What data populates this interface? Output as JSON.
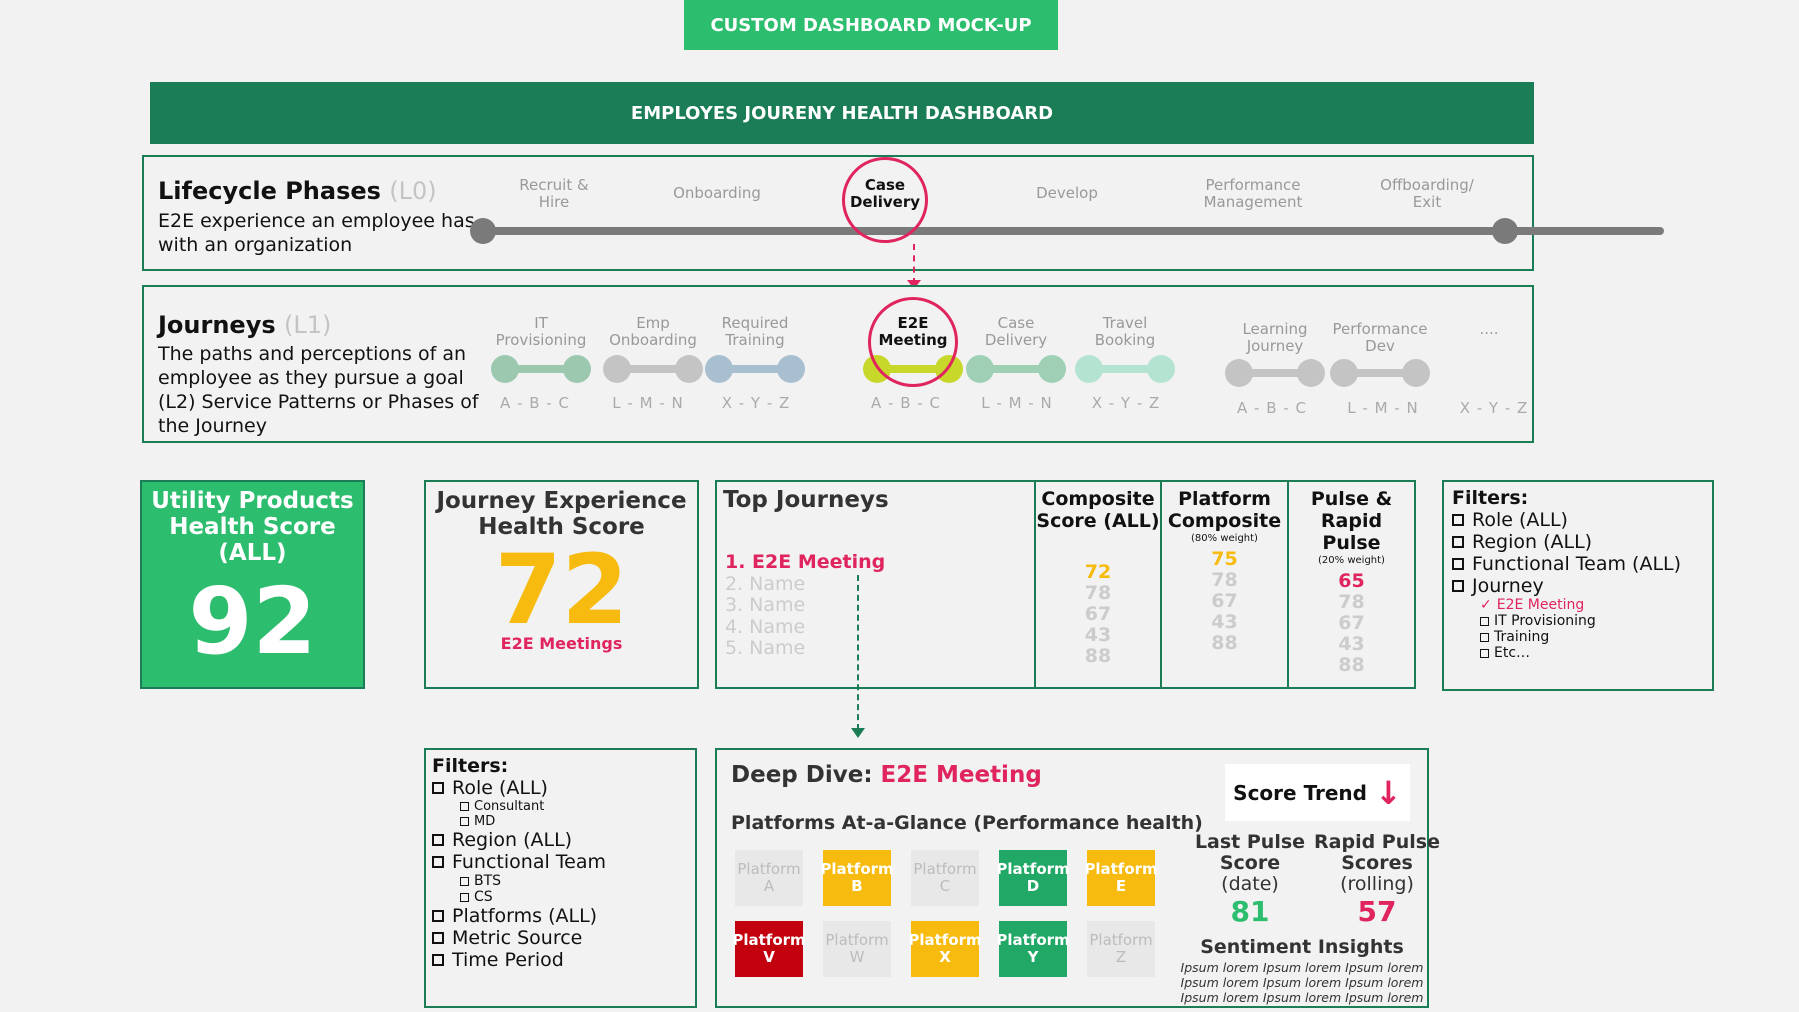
{
  "banner": "CUSTOM DASHBOARD MOCK-UP",
  "header": "EMPLOYES JOURENY HEALTH DASHBOARD",
  "lifecycle": {
    "title": "Lifecycle Phases",
    "level": "(L0)",
    "desc_line1": "E2E experience an employee has",
    "desc_line2": "with an organization",
    "phases": [
      {
        "l1": "Recruit &",
        "l2": "Hire"
      },
      {
        "l1": "Onboarding",
        "l2": ""
      },
      {
        "l1": "Case",
        "l2": "Delivery"
      },
      {
        "l1": "Develop",
        "l2": ""
      },
      {
        "l1": "Performance",
        "l2": "Management"
      },
      {
        "l1": "Offboarding/",
        "l2": "Exit"
      }
    ]
  },
  "journeys": {
    "title": "Journeys",
    "level": "(L1)",
    "desc": [
      "The paths and perceptions of an",
      "employee as they pursue a goal",
      "(L2) Service Patterns or Phases of",
      "the Journey"
    ],
    "items": [
      {
        "l1": "IT",
        "l2": "Provisioning"
      },
      {
        "l1": "Emp",
        "l2": "Onboarding"
      },
      {
        "l1": "Required",
        "l2": "Training"
      },
      {
        "l1": "E2E",
        "l2": "Meeting"
      },
      {
        "l1": "Case",
        "l2": "Delivery"
      },
      {
        "l1": "Travel",
        "l2": "Booking"
      },
      {
        "l1": "Learning",
        "l2": "Journey"
      },
      {
        "l1": "Performance",
        "l2": "Dev"
      },
      {
        "l1": "....",
        "l2": ""
      }
    ],
    "codes": [
      "A - B - C",
      "L - M - N",
      "X - Y - Z",
      "A - B - C",
      "L - M - N",
      "X - Y - Z",
      "A - B - C",
      "L - M - N",
      "X - Y - Z"
    ]
  },
  "utility": {
    "l1": "Utility Products",
    "l2": "Health Score",
    "l3": "(ALL)",
    "score": "92"
  },
  "journey_score": {
    "l1": "Journey Experience",
    "l2": "Health Score",
    "score": "72",
    "caption": "E2E Meetings"
  },
  "top": {
    "title": "Top Journeys",
    "list": [
      "1. E2E Meeting",
      "2. Name",
      "3. Name",
      "4. Name",
      "5. Name"
    ],
    "col1": {
      "h1": "Composite",
      "h2": "Score (ALL)",
      "note": ""
    },
    "col2": {
      "h1": "Platform",
      "h2": "Composite",
      "note": "(80% weight)"
    },
    "col3": {
      "h1": "Pulse &",
      "h2": "Rapid Pulse",
      "note": "(20% weight)"
    },
    "v1": [
      "72",
      "78",
      "67",
      "43",
      "88"
    ],
    "v2": [
      "75",
      "78",
      "67",
      "43",
      "88"
    ],
    "v3": [
      "65",
      "78",
      "67",
      "43",
      "88"
    ]
  },
  "filters_right": {
    "title": "Filters:",
    "items": [
      "Role (ALL)",
      "Region (ALL)",
      "Functional Team (ALL)",
      "Journey"
    ],
    "checked": "E2E Meeting",
    "subs": [
      "IT Provisioning",
      "Training",
      "Etc…"
    ]
  },
  "filters_left": {
    "title": "Filters:",
    "role": "Role (ALL)",
    "role_subs": [
      "Consultant",
      "MD"
    ],
    "region": "Region (ALL)",
    "team": "Functional Team",
    "team_subs": [
      "BTS",
      "CS"
    ],
    "rest": [
      "Platforms (ALL)",
      "Metric Source",
      "Time Period"
    ]
  },
  "deep": {
    "label": "Deep Dive:",
    "name": "E2E Meeting",
    "subtitle": "Platforms At-a-Glance (Performance health)",
    "tiles": [
      {
        "l1": "Platform",
        "l2": "A",
        "s": "grey"
      },
      {
        "l1": "Platform",
        "l2": "B",
        "s": "yel"
      },
      {
        "l1": "Platform",
        "l2": "C",
        "s": "grey"
      },
      {
        "l1": "Platform",
        "l2": "D",
        "s": "grn"
      },
      {
        "l1": "Platform",
        "l2": "E",
        "s": "yel"
      },
      {
        "l1": "Platform",
        "l2": "V",
        "s": "red"
      },
      {
        "l1": "Platform",
        "l2": "W",
        "s": "grey"
      },
      {
        "l1": "Platform",
        "l2": "X",
        "s": "yel"
      },
      {
        "l1": "Platform",
        "l2": "Y",
        "s": "grn"
      },
      {
        "l1": "Platform",
        "l2": "Z",
        "s": "grey"
      }
    ],
    "trend": "Score Trend",
    "last": {
      "l1": "Last Pulse",
      "l2": "Score",
      "l3": "(date)",
      "v": "81"
    },
    "rapid": {
      "l1": "Rapid Pulse",
      "l2": "Scores",
      "l3": "(rolling)",
      "v": "57"
    },
    "sentiment": "Sentiment Insights",
    "ipsum": "Ipsum lorem Ipsum lorem Ipsum lorem"
  },
  "colors": {
    "green": "#2dbd6e",
    "dark": "#1a7d55",
    "pink": "#e0245e",
    "yellow": "#f7bb0f"
  }
}
